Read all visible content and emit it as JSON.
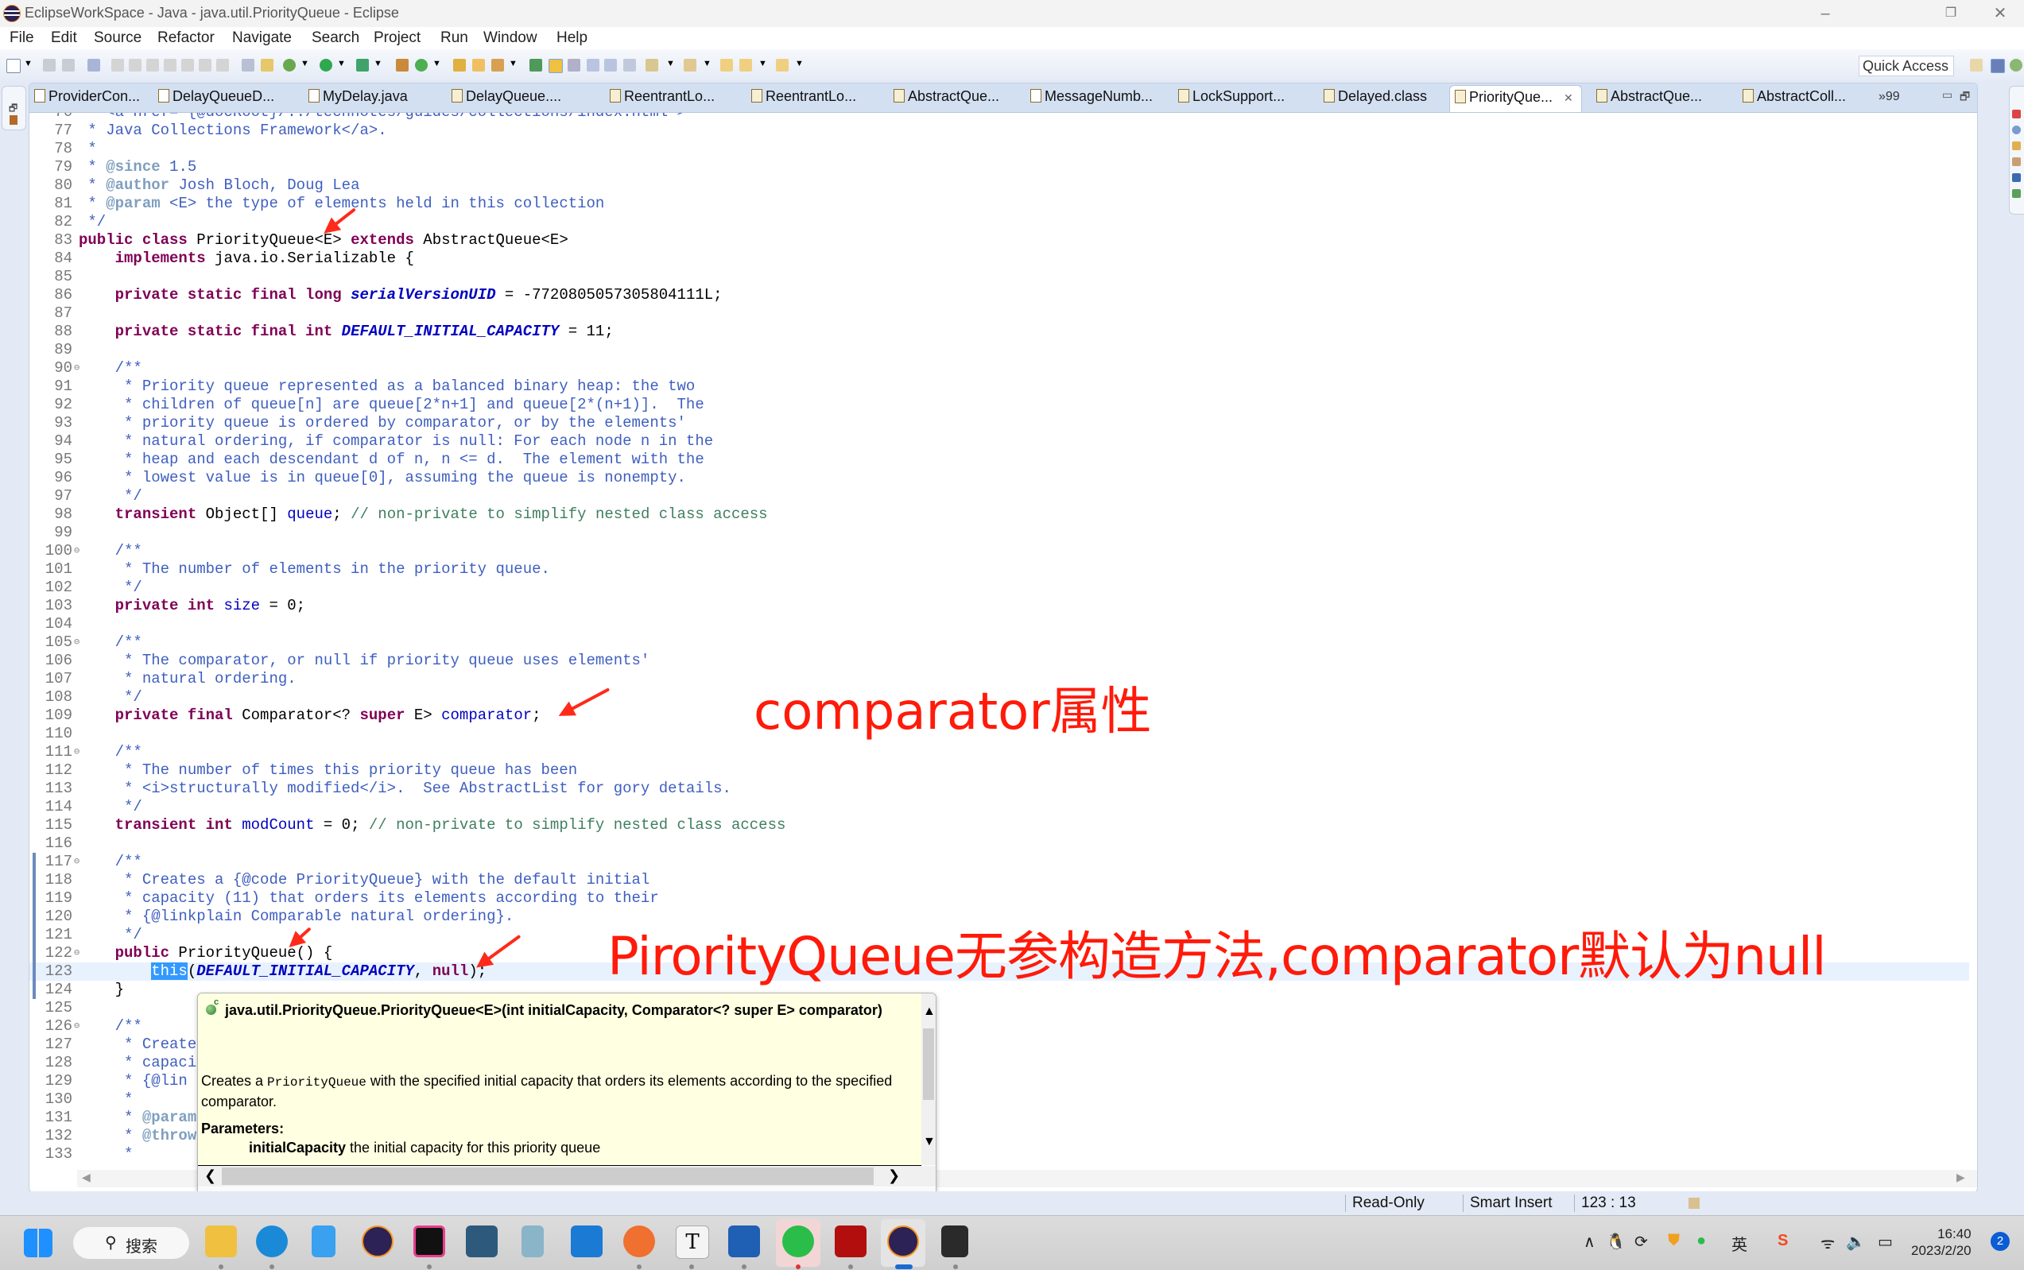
{
  "window": {
    "title": "EclipseWorkSpace - Java - java.util.PriorityQueue - Eclipse",
    "minimize": "–",
    "restore": "❐",
    "close": "✕"
  },
  "menu": [
    "File",
    "Edit",
    "Source",
    "Refactor",
    "Navigate",
    "Search",
    "Project",
    "Run",
    "Window",
    "Help"
  ],
  "toolbar": {
    "quick_access": "Quick Access"
  },
  "tabs": [
    {
      "label": "ProviderCon...",
      "kind": "java"
    },
    {
      "label": "DelayQueueD...",
      "kind": "java"
    },
    {
      "label": "MyDelay.java",
      "kind": "java"
    },
    {
      "label": "DelayQueue....",
      "kind": "class"
    },
    {
      "label": "ReentrantLo...",
      "kind": "class"
    },
    {
      "label": "ReentrantLo...",
      "kind": "class"
    },
    {
      "label": "AbstractQue...",
      "kind": "class"
    },
    {
      "label": "MessageNumb...",
      "kind": "java"
    },
    {
      "label": "LockSupport...",
      "kind": "class"
    },
    {
      "label": "Delayed.class",
      "kind": "class"
    },
    {
      "label": "PriorityQue...",
      "kind": "class",
      "active": true
    },
    {
      "label": "AbstractQue...",
      "kind": "class"
    },
    {
      "label": "AbstractColl...",
      "kind": "class"
    }
  ],
  "tabs_overflow": "»99",
  "editor": {
    "current_line": 123,
    "lines": [
      {
        "n": "76",
        "segs": [
          [
            "cm",
            " * <a href=\"{@docRoot}/../technotes/guides/collections/index.html\">"
          ]
        ]
      },
      {
        "n": "77",
        "segs": [
          [
            "cm",
            " * Java Collections Framework</a>."
          ]
        ]
      },
      {
        "n": "78",
        "segs": [
          [
            "cm",
            " *"
          ]
        ]
      },
      {
        "n": "79",
        "segs": [
          [
            "cm",
            " * "
          ],
          [
            "jd",
            "@since"
          ],
          [
            "cm",
            " 1.5"
          ]
        ]
      },
      {
        "n": "80",
        "segs": [
          [
            "cm",
            " * "
          ],
          [
            "jd",
            "@author"
          ],
          [
            "cm",
            " Josh Bloch, Doug Lea"
          ]
        ]
      },
      {
        "n": "81",
        "segs": [
          [
            "cm",
            " * "
          ],
          [
            "jd",
            "@param"
          ],
          [
            "cm",
            " <E> the type of elements held in this collection"
          ]
        ]
      },
      {
        "n": "82",
        "segs": [
          [
            "cm",
            " */"
          ]
        ]
      },
      {
        "n": "83",
        "segs": [
          [
            "kw",
            "public"
          ],
          [
            "plain",
            " "
          ],
          [
            "kw",
            "class"
          ],
          [
            "plain",
            " PriorityQueue<E> "
          ],
          [
            "kw",
            "extends"
          ],
          [
            "plain",
            " AbstractQueue<E>"
          ]
        ]
      },
      {
        "n": "84",
        "segs": [
          [
            "plain",
            "    "
          ],
          [
            "kw",
            "implements"
          ],
          [
            "plain",
            " java.io.Serializable {"
          ]
        ]
      },
      {
        "n": "85",
        "segs": []
      },
      {
        "n": "86",
        "segs": [
          [
            "plain",
            "    "
          ],
          [
            "kw",
            "private static final long"
          ],
          [
            "plain",
            " "
          ],
          [
            "sf",
            "serialVersionUID"
          ],
          [
            "plain",
            " = -7720805057305804111L;"
          ]
        ]
      },
      {
        "n": "87",
        "segs": []
      },
      {
        "n": "88",
        "segs": [
          [
            "plain",
            "    "
          ],
          [
            "kw",
            "private static final int"
          ],
          [
            "plain",
            " "
          ],
          [
            "sf",
            "DEFAULT_INITIAL_CAPACITY"
          ],
          [
            "plain",
            " = 11;"
          ]
        ]
      },
      {
        "n": "89",
        "segs": []
      },
      {
        "n": "90",
        "fold": true,
        "segs": [
          [
            "cm",
            "    /**"
          ]
        ]
      },
      {
        "n": "91",
        "segs": [
          [
            "cm",
            "     * Priority queue represented as a balanced binary heap: the two"
          ]
        ]
      },
      {
        "n": "92",
        "segs": [
          [
            "cm",
            "     * children of queue[n] are queue[2*n+1] and queue[2*(n+1)].  The"
          ]
        ]
      },
      {
        "n": "93",
        "segs": [
          [
            "cm",
            "     * priority queue is ordered by comparator, or by the elements'"
          ]
        ]
      },
      {
        "n": "94",
        "segs": [
          [
            "cm",
            "     * natural ordering, if comparator is null: For each node n in the"
          ]
        ]
      },
      {
        "n": "95",
        "segs": [
          [
            "cm",
            "     * heap and each descendant d of n, n <= d.  The element with the"
          ]
        ]
      },
      {
        "n": "96",
        "segs": [
          [
            "cm",
            "     * lowest value is in queue[0], assuming the queue is nonempty."
          ]
        ]
      },
      {
        "n": "97",
        "segs": [
          [
            "cm",
            "     */"
          ]
        ]
      },
      {
        "n": "98",
        "segs": [
          [
            "plain",
            "    "
          ],
          [
            "kw",
            "transient"
          ],
          [
            "plain",
            " Object[] "
          ],
          [
            "fld",
            "queue"
          ],
          [
            "plain",
            "; "
          ],
          [
            "sl",
            "// non-private to simplify nested class access"
          ]
        ]
      },
      {
        "n": "99",
        "segs": []
      },
      {
        "n": "100",
        "fold": true,
        "segs": [
          [
            "cm",
            "    /**"
          ]
        ]
      },
      {
        "n": "101",
        "segs": [
          [
            "cm",
            "     * The number of elements in the priority queue."
          ]
        ]
      },
      {
        "n": "102",
        "segs": [
          [
            "cm",
            "     */"
          ]
        ]
      },
      {
        "n": "103",
        "segs": [
          [
            "plain",
            "    "
          ],
          [
            "kw",
            "private int"
          ],
          [
            "plain",
            " "
          ],
          [
            "fld",
            "size"
          ],
          [
            "plain",
            " = 0;"
          ]
        ]
      },
      {
        "n": "104",
        "segs": []
      },
      {
        "n": "105",
        "fold": true,
        "segs": [
          [
            "cm",
            "    /**"
          ]
        ]
      },
      {
        "n": "106",
        "segs": [
          [
            "cm",
            "     * The comparator, or null if priority queue uses elements'"
          ]
        ]
      },
      {
        "n": "107",
        "segs": [
          [
            "cm",
            "     * natural ordering."
          ]
        ]
      },
      {
        "n": "108",
        "segs": [
          [
            "cm",
            "     */"
          ]
        ]
      },
      {
        "n": "109",
        "segs": [
          [
            "plain",
            "    "
          ],
          [
            "kw",
            "private final"
          ],
          [
            "plain",
            " Comparator<? "
          ],
          [
            "kw",
            "super"
          ],
          [
            "plain",
            " E> "
          ],
          [
            "fld",
            "comparator"
          ],
          [
            "plain",
            ";"
          ]
        ]
      },
      {
        "n": "110",
        "segs": []
      },
      {
        "n": "111",
        "fold": true,
        "segs": [
          [
            "cm",
            "    /**"
          ]
        ]
      },
      {
        "n": "112",
        "segs": [
          [
            "cm",
            "     * The number of times this priority queue has been"
          ]
        ]
      },
      {
        "n": "113",
        "segs": [
          [
            "cm",
            "     * <i>structurally modified</i>.  See AbstractList for gory details."
          ]
        ]
      },
      {
        "n": "114",
        "segs": [
          [
            "cm",
            "     */"
          ]
        ]
      },
      {
        "n": "115",
        "segs": [
          [
            "plain",
            "    "
          ],
          [
            "kw",
            "transient int"
          ],
          [
            "plain",
            " "
          ],
          [
            "fld",
            "modCount"
          ],
          [
            "plain",
            " = 0; "
          ],
          [
            "sl",
            "// non-private to simplify nested class access"
          ]
        ]
      },
      {
        "n": "116",
        "segs": []
      },
      {
        "n": "117",
        "fold": true,
        "segs": [
          [
            "cm",
            "    /**"
          ]
        ]
      },
      {
        "n": "118",
        "segs": [
          [
            "cm",
            "     * Creates a {@code PriorityQueue} with the default initial"
          ]
        ]
      },
      {
        "n": "119",
        "segs": [
          [
            "cm",
            "     * capacity (11) that orders its elements according to their"
          ]
        ]
      },
      {
        "n": "120",
        "segs": [
          [
            "cm",
            "     * {@linkplain Comparable natural ordering}."
          ]
        ]
      },
      {
        "n": "121",
        "segs": [
          [
            "cm",
            "     */"
          ]
        ]
      },
      {
        "n": "122",
        "fold": true,
        "segs": [
          [
            "plain",
            "    "
          ],
          [
            "kw",
            "public"
          ],
          [
            "plain",
            " PriorityQueue() {"
          ]
        ]
      },
      {
        "n": "123",
        "segs": [
          [
            "plain",
            "        "
          ],
          [
            "sel",
            "this"
          ],
          [
            "plain",
            "("
          ],
          [
            "sf",
            "DEFAULT_INITIAL_CAPACITY"
          ],
          [
            "plain",
            ", "
          ],
          [
            "kw",
            "null"
          ],
          [
            "plain",
            ");"
          ]
        ]
      },
      {
        "n": "124",
        "segs": [
          [
            "plain",
            "    }"
          ]
        ]
      },
      {
        "n": "125",
        "segs": []
      },
      {
        "n": "126",
        "fold": true,
        "segs": [
          [
            "cm",
            "    /**"
          ]
        ]
      },
      {
        "n": "127",
        "segs": [
          [
            "cm",
            "     * Create"
          ]
        ]
      },
      {
        "n": "128",
        "segs": [
          [
            "cm",
            "     * capaci"
          ]
        ]
      },
      {
        "n": "129",
        "segs": [
          [
            "cm",
            "     * {@lin"
          ]
        ]
      },
      {
        "n": "130",
        "segs": [
          [
            "cm",
            "     *"
          ]
        ]
      },
      {
        "n": "131",
        "segs": [
          [
            "cm",
            "     * "
          ],
          [
            "jd",
            "@param"
          ]
        ]
      },
      {
        "n": "132",
        "segs": [
          [
            "cm",
            "     * "
          ],
          [
            "jd",
            "@throw"
          ]
        ]
      },
      {
        "n": "133",
        "segs": [
          [
            "cm",
            "     *"
          ]
        ]
      }
    ]
  },
  "hover": {
    "signature": "java.util.PriorityQueue.PriorityQueue<E>(int initialCapacity, Comparator<? super E> comparator)",
    "desc_before": "Creates a ",
    "desc_code": "PriorityQueue",
    "desc_after": " with the specified initial capacity that orders its elements according to the specified comparator.",
    "params_heading": "Parameters:",
    "param_name": "initialCapacity",
    "param_desc": " the initial capacity for this priority queue"
  },
  "annotations": {
    "note1": "comparator属性",
    "note2": "PirorityQueue无参构造方法,comparator默认为null",
    "color": "#ff1a0a"
  },
  "status": {
    "mode": "Read-Only",
    "insert": "Smart Insert",
    "position": "123 : 13"
  },
  "taskbar": {
    "search_label": "搜索",
    "ime": "英",
    "time": "16:40",
    "date": "2023/2/20",
    "notifications": "2"
  }
}
